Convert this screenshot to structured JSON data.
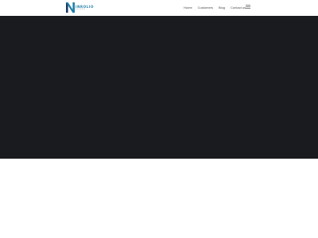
{
  "header": {
    "logo": {
      "icon": "n-logo-icon",
      "name": "INROLIO",
      "tagline": "BUSINESS"
    },
    "nav": [
      {
        "label": "Home"
      },
      {
        "label": "Customers"
      },
      {
        "label": "Blog"
      },
      {
        "label": "Contact us"
      }
    ],
    "menu_icon": "hamburger-menu-icon"
  },
  "colors": {
    "brand_blue": "#1f7fa8",
    "logo_navy": "#1e3a5f",
    "hero_background": "#1a1b1e",
    "page_background": "#ffffff"
  }
}
